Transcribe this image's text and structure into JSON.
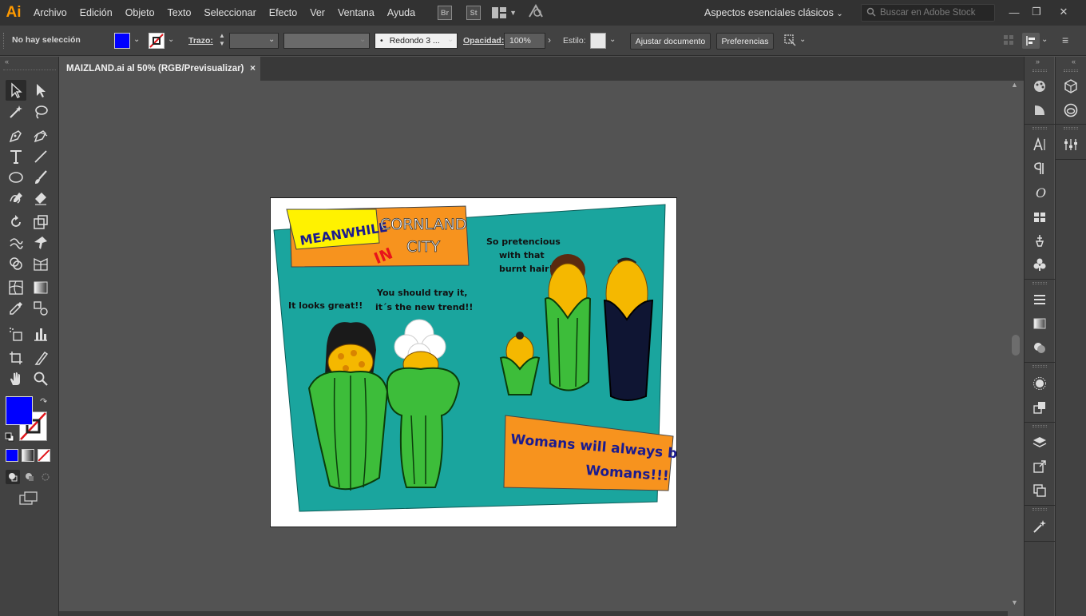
{
  "app": {
    "logo": "Ai"
  },
  "menu": [
    "Archivo",
    "Edición",
    "Objeto",
    "Texto",
    "Seleccionar",
    "Efecto",
    "Ver",
    "Ventana",
    "Ayuda"
  ],
  "menu_icons": {
    "bridge": "Br",
    "stock": "St"
  },
  "workspace": "Aspectos esenciales clásicos",
  "search": {
    "placeholder": "Buscar en Adobe Stock"
  },
  "control": {
    "selection_status": "No hay selección",
    "fill_color": "#0000ff",
    "stroke_label": "Trazo:",
    "brush_label": "Redondo 3 ...",
    "opacity_label": "Opacidad:",
    "opacity_value": "100%",
    "style_label": "Estilo:",
    "fit_document": "Ajustar documento",
    "preferences": "Preferencias"
  },
  "document": {
    "tab_title": "MAIZLAND.ai al 50% (RGB/Previsualizar)",
    "close_glyph": "×"
  },
  "toolbox": {
    "fill_color": "#0000ff",
    "stroke": "none"
  },
  "artwork": {
    "title_left": "MEANWHILE",
    "title_right_1": "CORNLAND",
    "title_in": "IN",
    "title_right_2": "CITY",
    "bubble1": "It looks great!!",
    "bubble2_line1": "You should tray it,",
    "bubble2_line2": "it´s the new trend!!",
    "bubble3_line1": "So pretencious",
    "bubble3_line2": "with that",
    "bubble3_line3": "burnt hair!",
    "caption_line1": "Womans will always be...",
    "caption_line2": "Womans!!!",
    "colors": {
      "teal": "#1aa59e",
      "orange": "#f7931e",
      "yellow": "#fff200",
      "green": "#3dbd3a",
      "navy": "#1b1b8f",
      "red": "#e8141b"
    }
  }
}
